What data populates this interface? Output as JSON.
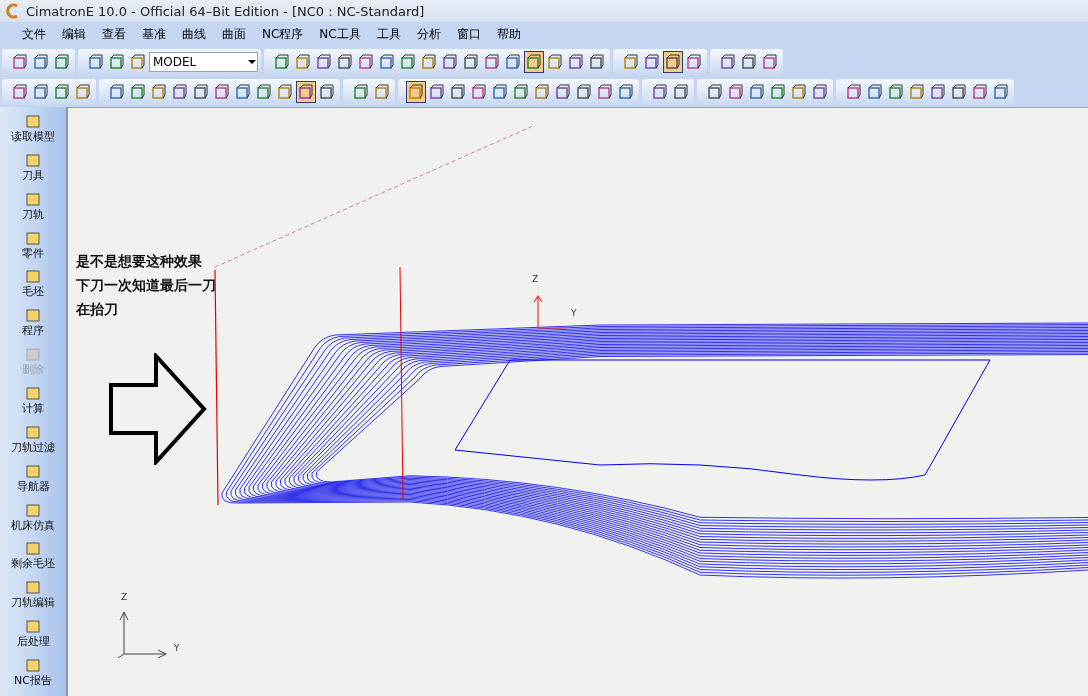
{
  "window": {
    "title": "CimatronE 10.0 - Official 64–Bit Edition - [NC0 : NC-Standard]"
  },
  "menu": [
    "文件",
    "编辑",
    "查看",
    "基准",
    "曲线",
    "曲面",
    "NC程序",
    "NC工具",
    "工具",
    "分析",
    "窗口",
    "帮助"
  ],
  "toolbar_top": {
    "groups": [
      {
        "buttons": [
          {
            "pressed": false
          },
          {
            "pressed": false
          },
          {
            "pressed": false
          }
        ]
      },
      {
        "buttons": [
          {
            "pressed": false
          },
          {
            "pressed": false
          },
          {
            "pressed": false
          }
        ],
        "combo": {
          "value": "MODEL"
        }
      },
      {
        "buttons": [
          {
            "pressed": false
          },
          {
            "pressed": false
          },
          {
            "pressed": false
          },
          {
            "pressed": false
          },
          {
            "pressed": false
          },
          {
            "pressed": false
          },
          {
            "pressed": false
          },
          {
            "pressed": false
          },
          {
            "pressed": false
          },
          {
            "pressed": false
          },
          {
            "pressed": false
          },
          {
            "pressed": false
          },
          {
            "pressed": true
          },
          {
            "pressed": false
          },
          {
            "pressed": false
          },
          {
            "pressed": false
          }
        ]
      },
      {
        "buttons": [
          {
            "pressed": false
          },
          {
            "pressed": false
          },
          {
            "pressed": true
          },
          {
            "pressed": false
          }
        ]
      },
      {
        "buttons": [
          {
            "pressed": false
          },
          {
            "pressed": false
          },
          {
            "pressed": false
          }
        ]
      }
    ]
  },
  "toolbar_second": {
    "groups": [
      {
        "buttons": [
          {
            "pressed": false
          },
          {
            "pressed": false
          },
          {
            "pressed": false
          },
          {
            "pressed": false
          }
        ]
      },
      {
        "buttons": [
          {
            "pressed": false
          },
          {
            "pressed": false
          },
          {
            "pressed": false
          },
          {
            "pressed": false
          },
          {
            "pressed": false
          },
          {
            "pressed": false
          },
          {
            "pressed": false
          },
          {
            "pressed": false
          },
          {
            "pressed": false
          },
          {
            "pressed": true
          },
          {
            "pressed": false
          }
        ]
      },
      {
        "buttons": [
          {
            "pressed": false
          },
          {
            "pressed": false
          }
        ]
      },
      {
        "buttons": [
          {
            "pressed": true
          },
          {
            "pressed": false
          },
          {
            "pressed": false
          },
          {
            "pressed": false
          },
          {
            "pressed": false
          },
          {
            "pressed": false
          },
          {
            "pressed": false
          },
          {
            "pressed": false
          },
          {
            "pressed": false
          },
          {
            "pressed": false
          },
          {
            "pressed": false
          }
        ]
      },
      {
        "buttons": [
          {
            "pressed": false
          },
          {
            "pressed": false
          }
        ]
      },
      {
        "buttons": [
          {
            "pressed": false
          },
          {
            "pressed": false
          },
          {
            "pressed": false
          },
          {
            "pressed": false
          },
          {
            "pressed": false
          },
          {
            "pressed": false
          }
        ]
      },
      {
        "buttons": [
          {
            "pressed": false
          },
          {
            "pressed": false
          },
          {
            "pressed": false
          },
          {
            "pressed": false
          },
          {
            "pressed": false
          },
          {
            "pressed": false
          },
          {
            "pressed": false
          },
          {
            "pressed": false
          }
        ]
      }
    ]
  },
  "sidebar": {
    "items": [
      {
        "label": "读取模型",
        "disabled": false
      },
      {
        "label": "刀具",
        "disabled": false
      },
      {
        "label": "刀轨",
        "disabled": false
      },
      {
        "label": "零件",
        "disabled": false
      },
      {
        "label": "毛坯",
        "disabled": false
      },
      {
        "label": "程序",
        "disabled": false
      },
      {
        "label": "删除",
        "disabled": true
      },
      {
        "label": "计算",
        "disabled": false
      },
      {
        "label": "刀轨过滤",
        "disabled": false
      },
      {
        "label": "导航器",
        "disabled": false
      },
      {
        "label": "机床仿真",
        "disabled": false
      },
      {
        "label": "剩余毛坯",
        "disabled": false
      },
      {
        "label": "刀轨编辑",
        "disabled": false
      },
      {
        "label": "后处理",
        "disabled": false
      },
      {
        "label": "NC报告",
        "disabled": false
      }
    ]
  },
  "viewport": {
    "note": [
      "是不是想要这种效果",
      "下刀一次知道最后一刀",
      "在抬刀"
    ],
    "part_axes": {
      "z": "Z",
      "y": "Y"
    },
    "world_axes": {
      "z": "Z",
      "y": "Y"
    }
  }
}
